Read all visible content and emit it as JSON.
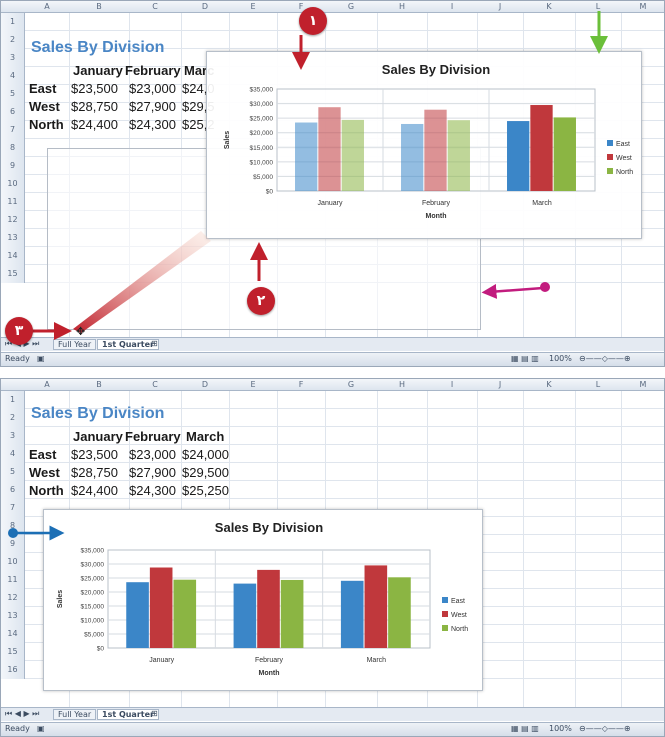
{
  "columns": [
    "A",
    "B",
    "C",
    "D",
    "E",
    "F",
    "G",
    "H",
    "I",
    "J",
    "K",
    "L",
    "M"
  ],
  "rows_top": [
    "1",
    "2",
    "3",
    "4",
    "5",
    "6",
    "7",
    "8",
    "9",
    "10",
    "11",
    "12",
    "13",
    "14",
    "15"
  ],
  "rows_bottom": [
    "1",
    "2",
    "3",
    "4",
    "5",
    "6",
    "7",
    "8",
    "9",
    "10",
    "11",
    "12",
    "13",
    "14",
    "15",
    "16"
  ],
  "sheet": {
    "title": "Sales By Division",
    "months": [
      "January",
      "February",
      "March"
    ],
    "month_partial": "Marc",
    "divisions": [
      {
        "name": "East",
        "values": [
          "$23,500",
          "$23,000",
          "$24,000"
        ],
        "partial": [
          "$24,0"
        ]
      },
      {
        "name": "West",
        "values": [
          "$28,750",
          "$27,900",
          "$29,500"
        ],
        "partial": [
          "$29,5"
        ]
      },
      {
        "name": "North",
        "values": [
          "$24,400",
          "$24,300",
          "$25,250"
        ],
        "partial": [
          "$25,2"
        ]
      }
    ]
  },
  "chart_data": [
    {
      "type": "bar",
      "title": "Sales By Division",
      "categories": [
        "January",
        "February",
        "March"
      ],
      "series": [
        {
          "name": "East",
          "values": [
            23500,
            23000,
            24000
          ],
          "color": "#3b86c8"
        },
        {
          "name": "West",
          "values": [
            28750,
            27900,
            29500
          ],
          "color": "#c0383c"
        },
        {
          "name": "North",
          "values": [
            24400,
            24300,
            25250
          ],
          "color": "#8bb543"
        }
      ],
      "xlabel": "Month",
      "ylabel": "Sales",
      "ylim": [
        0,
        35000
      ],
      "yticks": [
        "$35,000",
        "$30,000",
        "$25,000",
        "$20,000",
        "$15,000",
        "$10,000",
        "$5,000",
        "$0"
      ],
      "legend": "right",
      "grid": true
    },
    {
      "type": "bar",
      "title": "Sales By Division",
      "categories": [
        "January",
        "February",
        "March"
      ],
      "series": [
        {
          "name": "East",
          "values": [
            23500,
            23000,
            24000
          ],
          "color": "#3b86c8"
        },
        {
          "name": "West",
          "values": [
            28750,
            27900,
            29500
          ],
          "color": "#c0383c"
        },
        {
          "name": "North",
          "values": [
            24400,
            24300,
            25250
          ],
          "color": "#8bb543"
        }
      ],
      "xlabel": "Month",
      "ylabel": "Sales",
      "ylim": [
        0,
        35000
      ],
      "yticks": [
        "$35,000",
        "$30,000",
        "$25,000",
        "$20,000",
        "$15,000",
        "$10,000",
        "$5,000",
        "$0"
      ],
      "legend": "right",
      "grid": true
    }
  ],
  "tabs": {
    "full_year": "Full Year",
    "first_quarter": "1st Quarter"
  },
  "status": {
    "ready": "Ready",
    "zoom": "100%"
  },
  "badges": {
    "one": "١",
    "two": "٢",
    "three": "٣"
  },
  "colors": {
    "title_blue": "#4a86c5",
    "arrow_red": "#c0202c",
    "arrow_magenta": "#c21c7e",
    "arrow_green": "#6bbf3a",
    "arrow_blue": "#1c6fb5"
  }
}
